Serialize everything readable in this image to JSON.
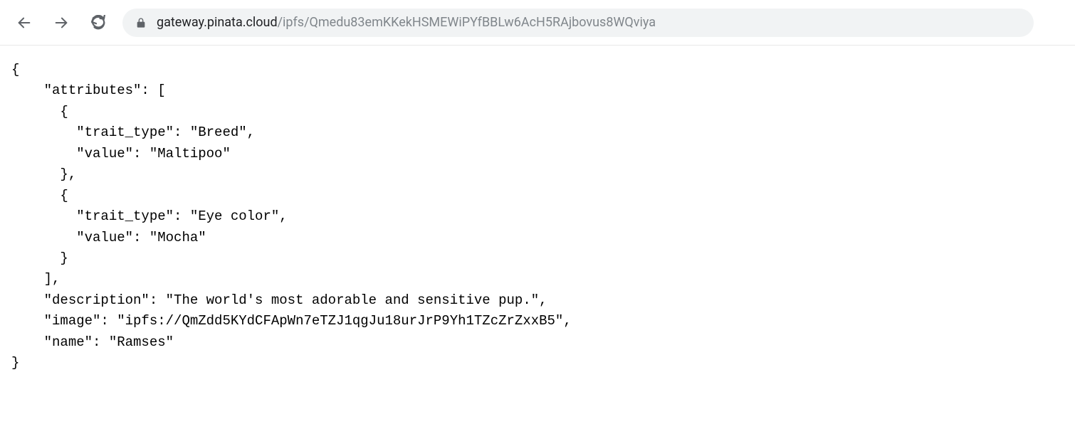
{
  "url": {
    "domain": "gateway.pinata.cloud",
    "path": "/ipfs/Qmedu83emKKekHSMEWiPYfBBLw6AcH5RAjbovus8WQviya"
  },
  "json_body": {
    "attributes": [
      {
        "trait_type": "Breed",
        "value": "Maltipoo"
      },
      {
        "trait_type": "Eye color",
        "value": "Mocha"
      }
    ],
    "description": "The world's most adorable and sensitive pup.",
    "image": "ipfs://QmZdd5KYdCFApWn7eTZJ1qgJu18urJrP9Yh1TZcZrZxxB5",
    "name": "Ramses"
  }
}
